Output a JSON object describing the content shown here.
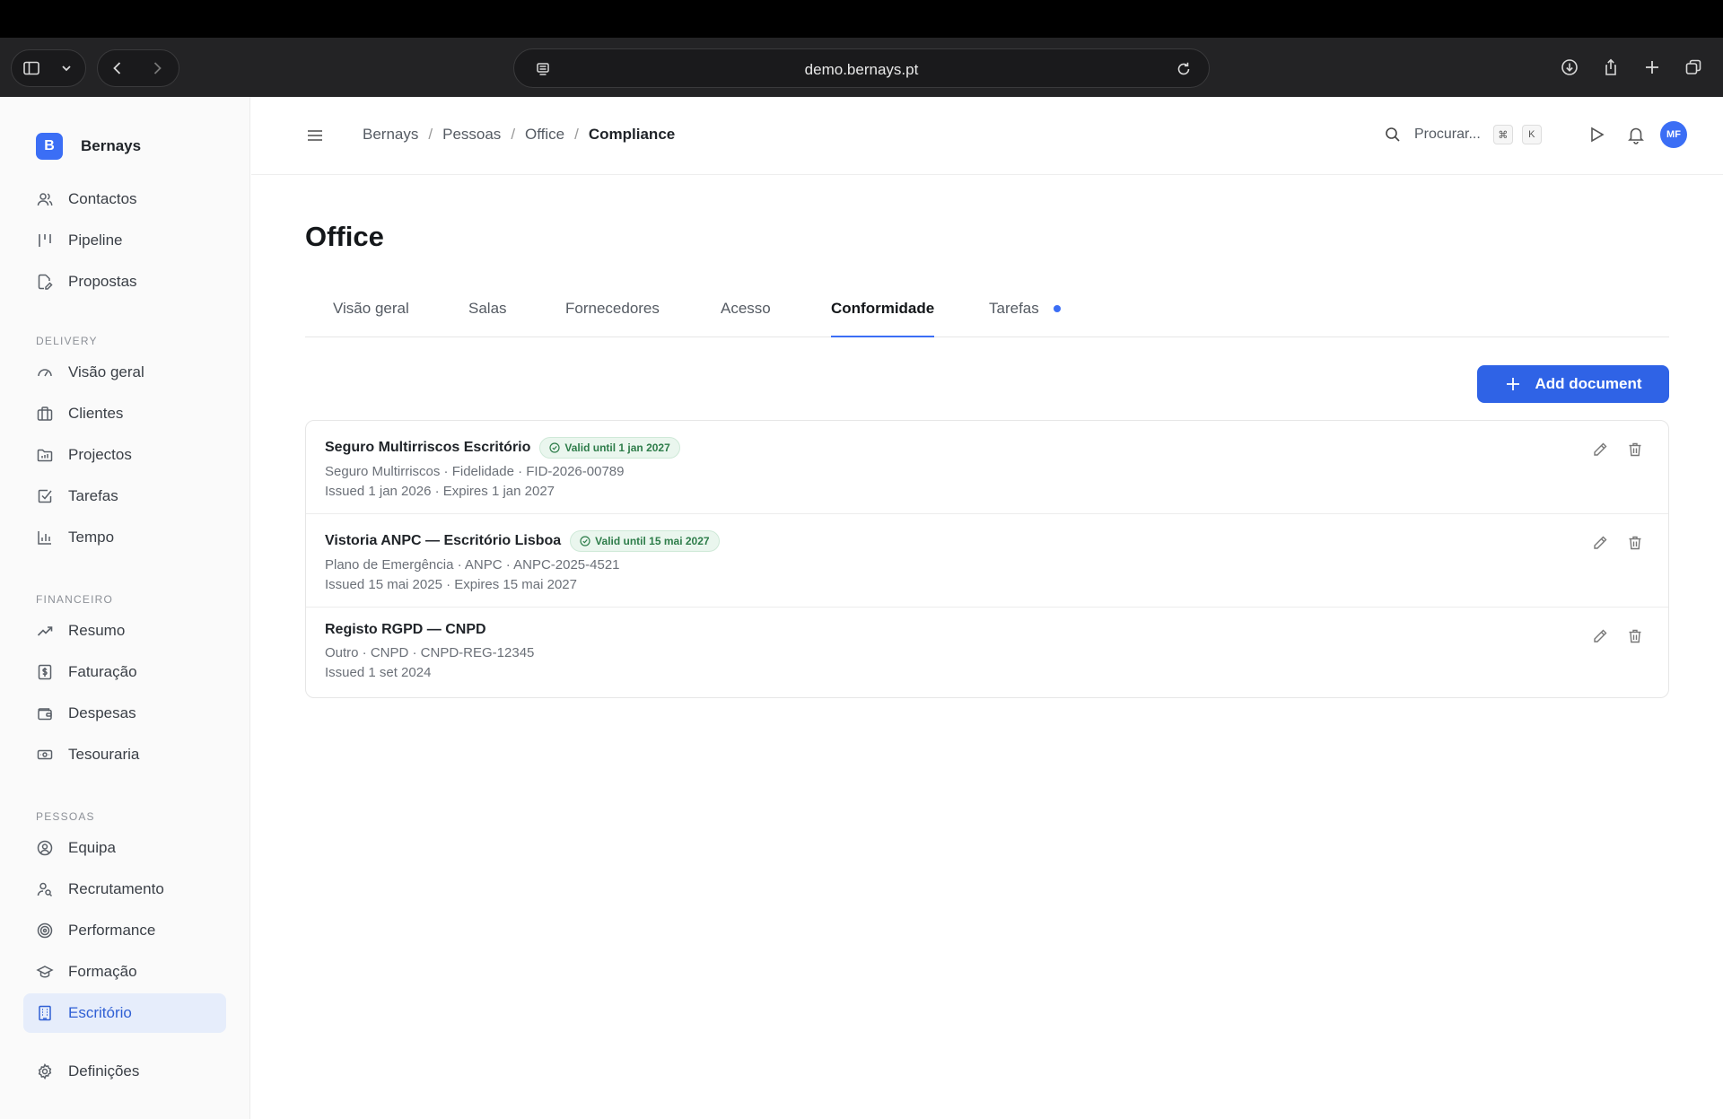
{
  "browser": {
    "url": "demo.bernays.pt"
  },
  "brand": {
    "logo_letter": "B",
    "name": "Bernays"
  },
  "sidebar": {
    "top_items": [
      {
        "label": "Contactos",
        "icon": "users-icon"
      },
      {
        "label": "Pipeline",
        "icon": "pipeline-icon"
      },
      {
        "label": "Propostas",
        "icon": "document-edit-icon"
      }
    ],
    "sections": [
      {
        "title": "DELIVERY",
        "items": [
          {
            "label": "Visão geral",
            "icon": "gauge-icon"
          },
          {
            "label": "Clientes",
            "icon": "briefcase-icon"
          },
          {
            "label": "Projectos",
            "icon": "folder-icon"
          },
          {
            "label": "Tarefas",
            "icon": "checkbox-icon"
          },
          {
            "label": "Tempo",
            "icon": "bar-chart-icon"
          }
        ]
      },
      {
        "title": "FINANCEIRO",
        "items": [
          {
            "label": "Resumo",
            "icon": "trend-up-icon"
          },
          {
            "label": "Faturação",
            "icon": "invoice-icon"
          },
          {
            "label": "Despesas",
            "icon": "wallet-icon"
          },
          {
            "label": "Tesouraria",
            "icon": "banknote-icon"
          }
        ]
      },
      {
        "title": "PESSOAS",
        "items": [
          {
            "label": "Equipa",
            "icon": "user-circle-icon"
          },
          {
            "label": "Recrutamento",
            "icon": "user-search-icon"
          },
          {
            "label": "Performance",
            "icon": "target-icon"
          },
          {
            "label": "Formação",
            "icon": "graduation-cap-icon"
          },
          {
            "label": "Escritório",
            "icon": "building-icon",
            "active": true
          }
        ]
      }
    ],
    "settings_label": "Definições"
  },
  "header": {
    "breadcrumb": [
      "Bernays",
      "Pessoas",
      "Office",
      "Compliance"
    ],
    "search_placeholder": "Procurar...",
    "shortcut_keys": [
      "⌘",
      "K"
    ],
    "avatar_initials": "MF"
  },
  "page": {
    "title": "Office",
    "tabs": [
      {
        "label": "Visão geral"
      },
      {
        "label": "Salas"
      },
      {
        "label": "Fornecedores"
      },
      {
        "label": "Acesso"
      },
      {
        "label": "Conformidade",
        "active": true
      },
      {
        "label": "Tarefas",
        "has_dot": true
      }
    ],
    "add_button_label": "Add document",
    "documents": [
      {
        "title": "Seguro Multirriscos Escritório",
        "badge": "Valid until 1 jan 2027",
        "meta": "Seguro Multirriscos · Fidelidade · FID-2026-00789",
        "dates": "Issued 1 jan 2026 · Expires 1 jan 2027"
      },
      {
        "title": "Vistoria ANPC — Escritório Lisboa",
        "badge": "Valid until 15 mai 2027",
        "meta": "Plano de Emergência · ANPC · ANPC-2025-4521",
        "dates": "Issued 15 mai 2025 · Expires 15 mai 2027"
      },
      {
        "title": "Registo RGPD — CNPD",
        "badge": "",
        "meta": "Outro · CNPD · CNPD-REG-12345",
        "dates": "Issued 1 set 2024"
      }
    ]
  },
  "colors": {
    "accent": "#2f63e6",
    "badge_green": "#2e7d4a",
    "active_nav_bg": "#e6edfb"
  }
}
